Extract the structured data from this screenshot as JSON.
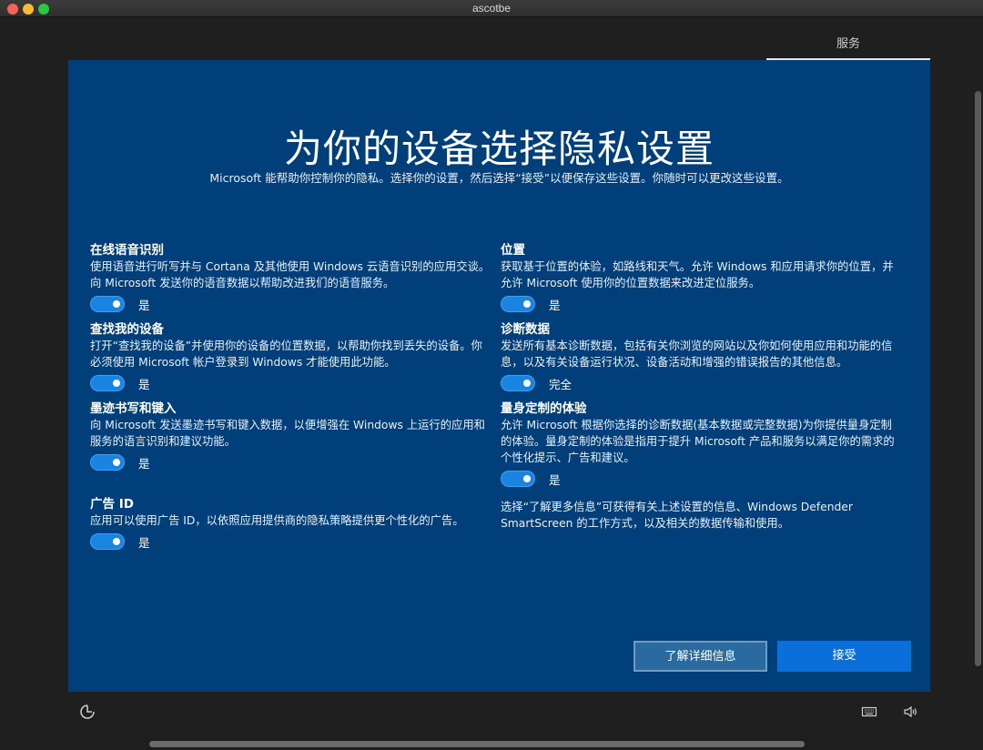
{
  "window": {
    "title": "ascotbe"
  },
  "tab": {
    "label": "服务"
  },
  "page": {
    "heading": "为你的设备选择隐私设置",
    "subheading": "Microsoft 能帮助你控制你的隐私。选择你的设置，然后选择“接受”以便保存这些设置。你随时可以更改这些设置。"
  },
  "settings_left": [
    {
      "title": "在线语音识别",
      "desc": "使用语音进行听写并与 Cortana 及其他使用 Windows 云语音识别的应用交谈。向 Microsoft 发送你的语音数据以帮助改进我们的语音服务。",
      "state": "是"
    },
    {
      "title": "查找我的设备",
      "desc": "打开“查找我的设备”并使用你的设备的位置数据，以帮助你找到丢失的设备。你必须使用 Microsoft 帐户登录到 Windows 才能使用此功能。",
      "state": "是"
    },
    {
      "title": "墨迹书写和键入",
      "desc": "向 Microsoft 发送墨迹书写和键入数据，以便增强在 Windows 上运行的应用和服务的语言识别和建议功能。",
      "state": "是"
    },
    {
      "title": "广告 ID",
      "desc": "应用可以使用广告 ID，以依照应用提供商的隐私策略提供更个性化的广告。",
      "state": "是"
    }
  ],
  "settings_right": [
    {
      "title": "位置",
      "desc": "获取基于位置的体验，如路线和天气。允许 Windows 和应用请求你的位置，并允许 Microsoft 使用你的位置数据来改进定位服务。",
      "state": "是"
    },
    {
      "title": "诊断数据",
      "desc": "发送所有基本诊断数据，包括有关你浏览的网站以及你如何使用应用和功能的信息，以及有关设备运行状况、设备活动和增强的错误报告的其他信息。",
      "state": "完全"
    },
    {
      "title": "量身定制的体验",
      "desc": "允许 Microsoft 根据你选择的诊断数据(基本数据或完整数据)为你提供量身定制的体验。量身定制的体验是指用于提升 Microsoft 产品和服务以满足你的需求的个性化提示、广告和建议。",
      "state": "是"
    }
  ],
  "footnote": "选择“了解更多信息”可获得有关上述设置的信息、Windows Defender SmartScreen 的工作方式，以及相关的数据传输和使用。",
  "buttons": {
    "learn_more": "了解详细信息",
    "accept": "接受"
  },
  "colors": {
    "background": "#003f7a",
    "toggle_on": "#1a85e0",
    "accept_button": "#0a6fd8"
  },
  "icons": {
    "bottom_left": "ease-of-access-icon",
    "bottom_right_1": "keyboard-icon",
    "bottom_right_2": "volume-icon"
  }
}
